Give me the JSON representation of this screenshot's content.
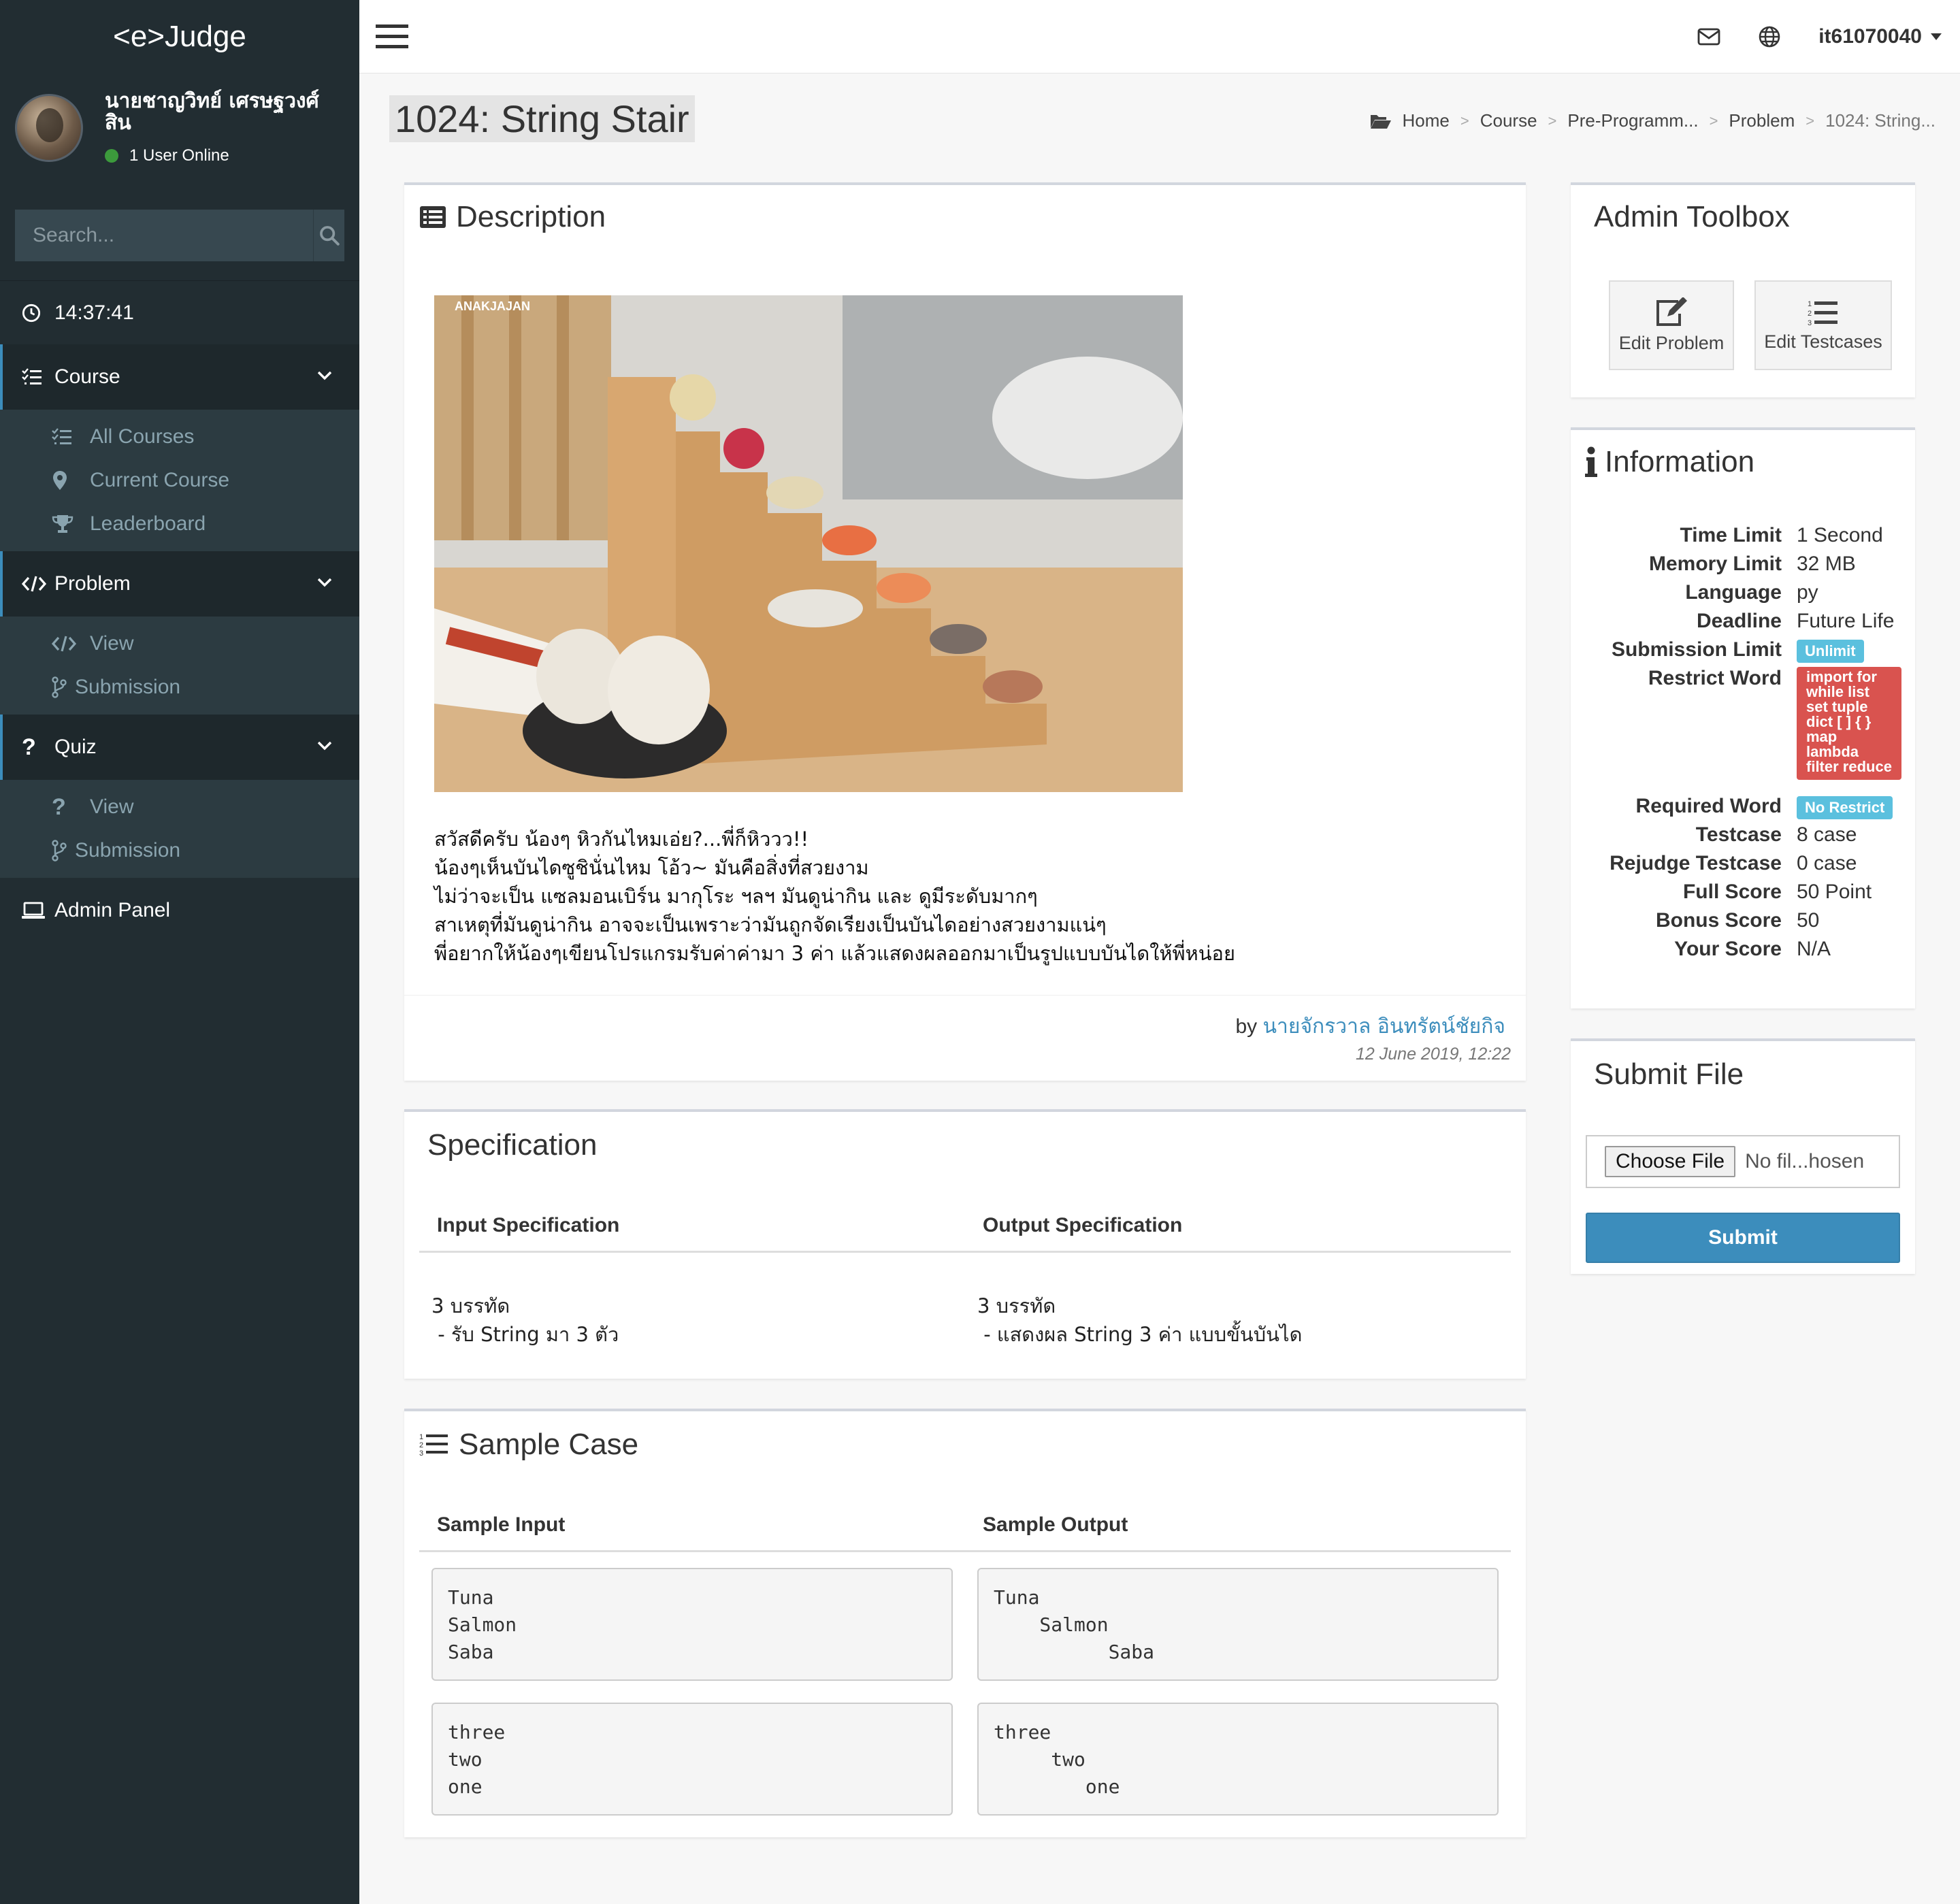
{
  "brand": "<e>Judge",
  "user": {
    "name": "นายชาญวิทย์ เศรษฐวงศ์สิน",
    "status": "1 User Online"
  },
  "search": {
    "placeholder": "Search..."
  },
  "clock": "14:37:41",
  "sidebar": {
    "course": {
      "label": "Course",
      "items": [
        "All Courses",
        "Current Course",
        "Leaderboard"
      ]
    },
    "problem": {
      "label": "Problem",
      "items": [
        "View",
        "Submission"
      ]
    },
    "quiz": {
      "label": "Quiz",
      "items": [
        "View",
        "Submission"
      ]
    },
    "admin": "Admin Panel"
  },
  "topbar": {
    "username": "it61070040"
  },
  "page": {
    "title": "1024: String Stair"
  },
  "breadcrumb": [
    "Home",
    "Course",
    "Pre-Programm...",
    "Problem",
    "1024: String..."
  ],
  "description": {
    "title": "Description",
    "image_watermark": "ANAKJAJAN",
    "lines": [
      "สวัสดีครับ น้องๆ หิวกันไหมเอ่ย?...พี่ก็หิววว!!",
      "น้องๆเห็นบันไดซูชินั่นไหม โอ้ว~ มันคือสิ่งที่สวยงาม",
      "ไม่ว่าจะเป็น แซลมอนเบิร์น มากุโระ ฯลฯ มันดูน่ากิน และ ดูมีระดับมากๆ",
      "สาเหตุที่มันดูน่ากิน อาจจะเป็นเพราะว่ามันถูกจัดเรียงเป็นบันไดอย่างสวยงามแน่ๆ",
      "พี่อยากให้น้องๆเขียนโปรแกรมรับค่าค่ามา 3 ค่า แล้วแสดงผลออกมาเป็นรูปแบบบันไดให้พี่หน่อย"
    ],
    "by_label": "by",
    "author": "นายจักรวาล อินทรัตน์ชัยกิจ",
    "date": "12 June 2019, 12:22"
  },
  "specification": {
    "title": "Specification",
    "input_head": "Input Specification",
    "output_head": "Output Specification",
    "input_lines": [
      "3 บรรทัด",
      " - รับ String มา 3 ตัว"
    ],
    "output_lines": [
      "3 บรรทัด",
      " - แสดงผล String 3 ค่า แบบขั้นบันได"
    ]
  },
  "sample": {
    "title": "Sample Case",
    "input_head": "Sample Input",
    "output_head": "Sample Output",
    "cases": [
      {
        "input": "Tuna\nSalmon\nSaba",
        "output": "Tuna\n    Salmon\n          Saba"
      },
      {
        "input": "three\ntwo\none",
        "output": "three\n     two\n        one"
      }
    ]
  },
  "admin_toolbox": {
    "title": "Admin Toolbox",
    "edit_problem": "Edit Problem",
    "edit_testcases": "Edit Testcases"
  },
  "information": {
    "title": "Information",
    "time_limit": {
      "label": "Time Limit",
      "value": "1 Second"
    },
    "memory_limit": {
      "label": "Memory Limit",
      "value": "32 MB"
    },
    "language": {
      "label": "Language",
      "value": "py"
    },
    "deadline": {
      "label": "Deadline",
      "value": "Future Life"
    },
    "submission_limit": {
      "label": "Submission Limit",
      "value": "Unlimit"
    },
    "restrict_word": {
      "label": "Restrict Word",
      "value": "import for while list set tuple dict [ ] { } map lambda filter reduce"
    },
    "required_word": {
      "label": "Required Word",
      "value": "No Restrict"
    },
    "testcase": {
      "label": "Testcase",
      "value": "8 case"
    },
    "rejudge_testcase": {
      "label": "Rejudge Testcase",
      "value": "0 case"
    },
    "full_score": {
      "label": "Full Score",
      "value": "50 Point"
    },
    "bonus_score": {
      "label": "Bonus Score",
      "value": "50"
    },
    "your_score": {
      "label": "Your Score",
      "value": "N/A"
    }
  },
  "submit_file": {
    "title": "Submit File",
    "choose_label": "Choose File",
    "no_file": "No fil...hosen",
    "submit_label": "Submit"
  },
  "colors": {
    "sidebar_bg": "#222d32",
    "accent": "#3c8dbc",
    "badge_info": "#5bc0de",
    "badge_danger": "#d9534f"
  }
}
